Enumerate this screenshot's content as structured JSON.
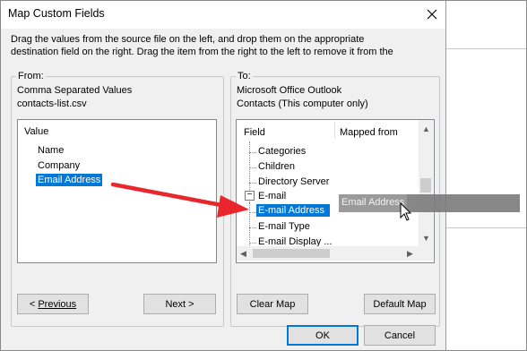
{
  "dialog": {
    "title": "Map Custom Fields",
    "instruction_line1": "Drag the values from the source file on the left, and drop them on the appropriate",
    "instruction_line2": "destination field on the right.  Drag the item from the right to the left to remove it from the"
  },
  "from": {
    "legend": "From:",
    "source_type": "Comma Separated Values",
    "source_file": "contacts-list.csv",
    "list_header": "Value",
    "items": [
      "Name",
      "Company",
      "Email Address"
    ],
    "selected_item": "Email Address",
    "previous_button": "Previous",
    "next_button": "Next >"
  },
  "to": {
    "legend": "To:",
    "dest_app": "Microsoft Office Outlook",
    "dest_folder": "Contacts (This computer only)",
    "col_field": "Field",
    "col_mapped": "Mapped from",
    "fields": [
      "Categories",
      "Children",
      "Directory Server",
      "E-mail",
      "E-mail Address",
      "E-mail Type",
      "E-mail Display ..."
    ],
    "expander": "−",
    "clear_map_button": "Clear Map",
    "default_map_button": "Default Map"
  },
  "drag": {
    "ghost_text": "Email Address"
  },
  "footer": {
    "ok_button": "OK",
    "cancel_button": "Cancel"
  },
  "colors": {
    "selection": "#0078d7",
    "arrow": "#e8262b",
    "dialog_bg": "#f0f0f0"
  }
}
